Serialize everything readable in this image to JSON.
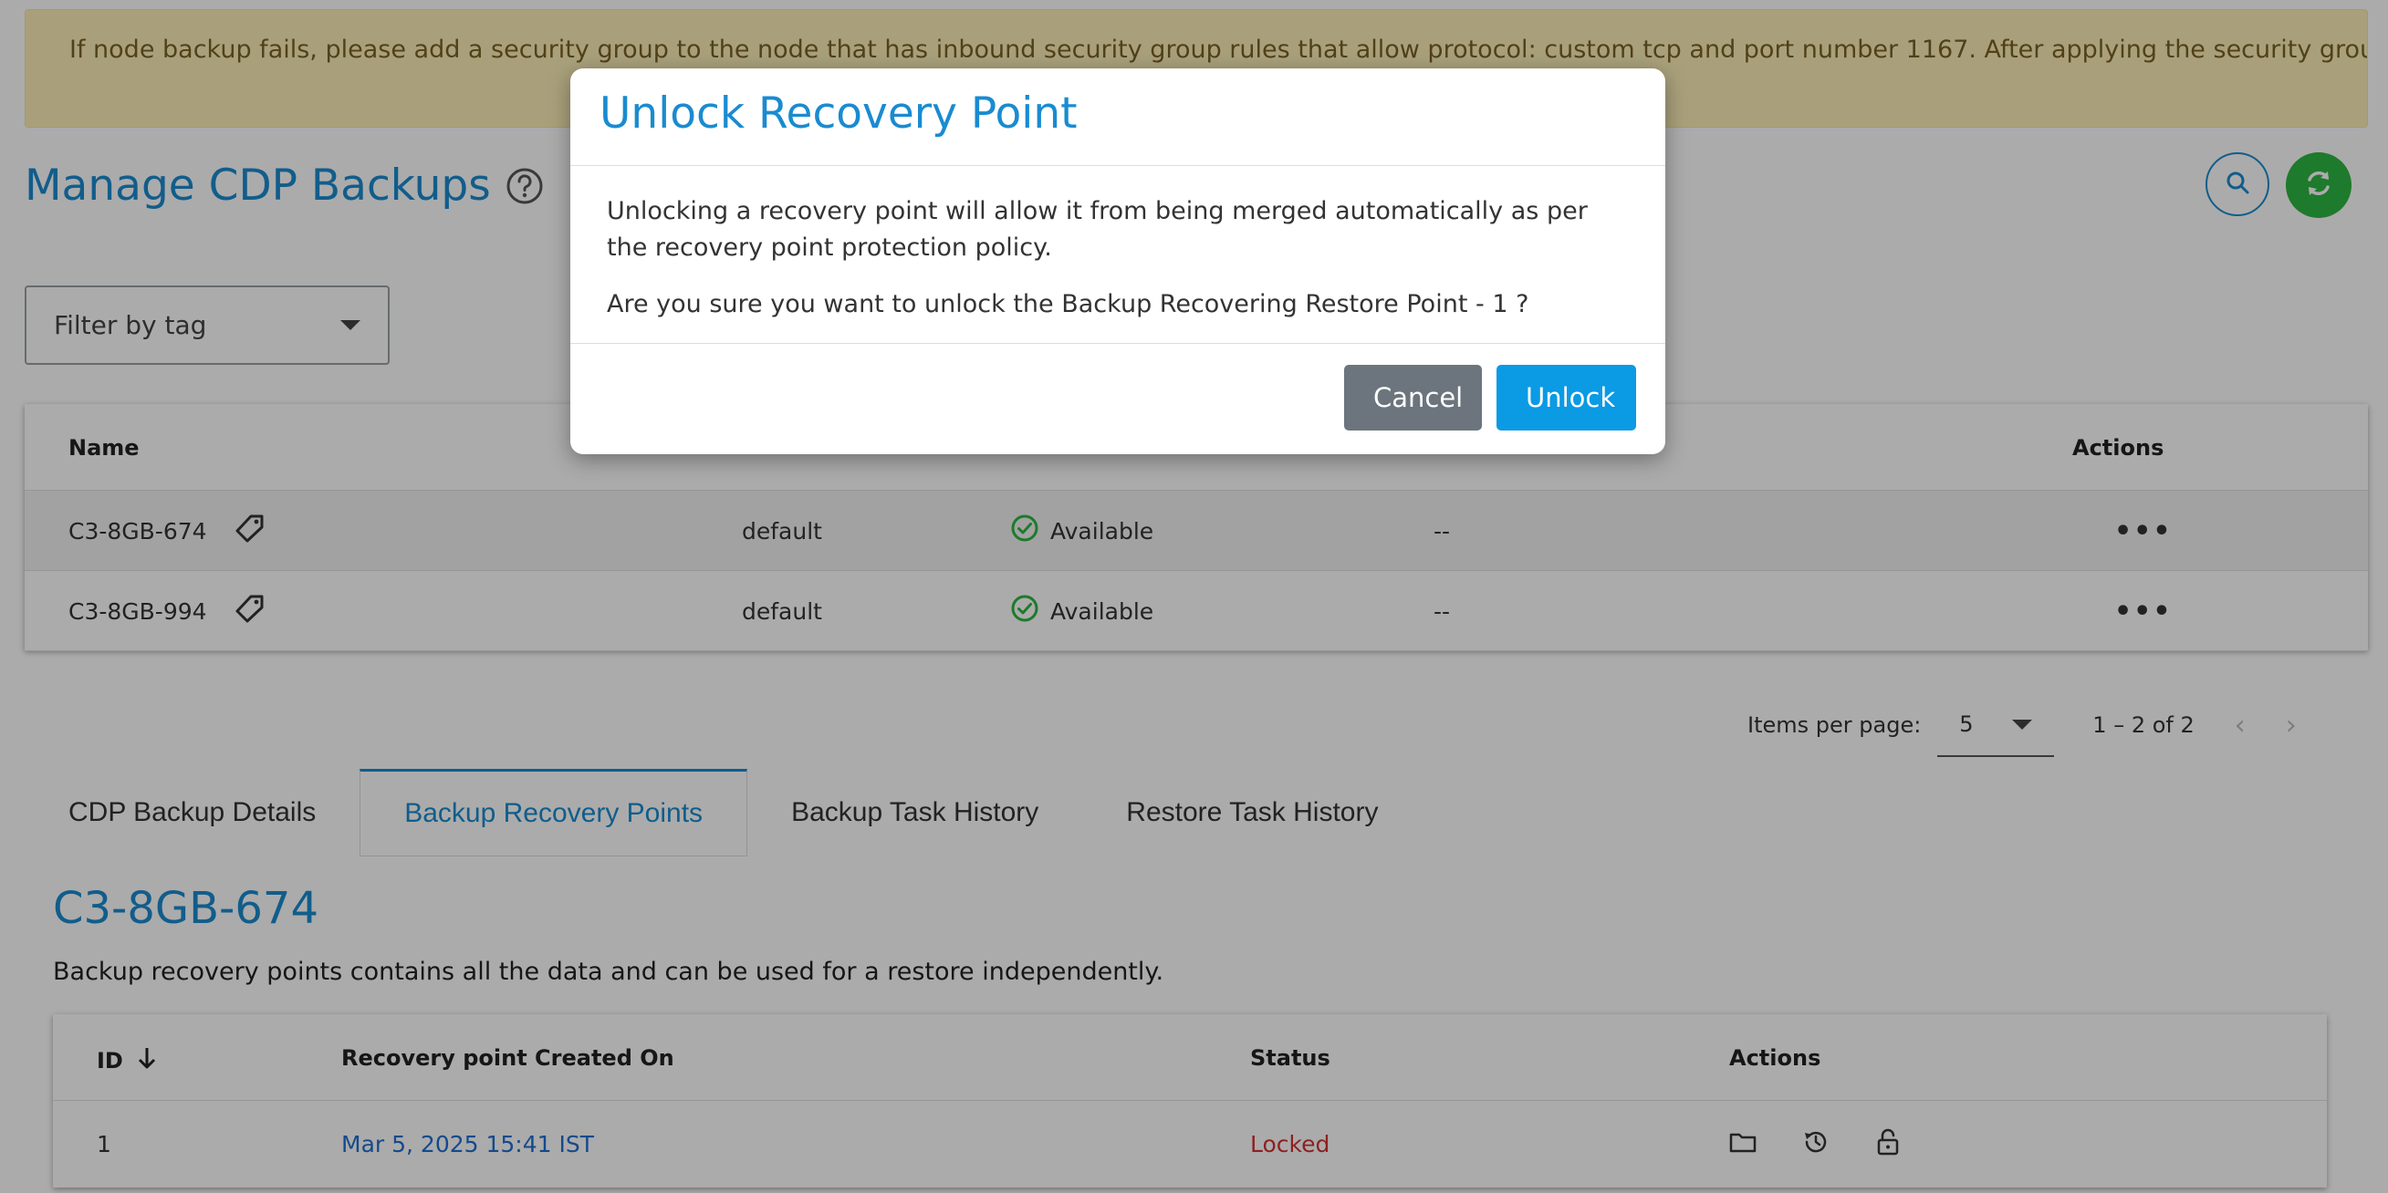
{
  "banner": {
    "text": "If node backup fails, please add a security group to the node that has inbound security group rules that allow protocol: custom tcp and port number 1167. After applying the security group to"
  },
  "header": {
    "title": "Manage CDP Backups",
    "help_icon": "question-circle-icon",
    "search_icon": "search-icon",
    "refresh_icon": "refresh-icon"
  },
  "filter": {
    "placeholder": "Filter by tag"
  },
  "backups_table": {
    "columns": {
      "name": "Name",
      "actions": "Actions"
    },
    "rows": [
      {
        "name": "C3-8GB-674",
        "group": "default",
        "status": "Available",
        "tag": "--",
        "actions": "•••"
      },
      {
        "name": "C3-8GB-994",
        "group": "default",
        "status": "Available",
        "tag": "--",
        "actions": "•••"
      }
    ]
  },
  "pagination": {
    "label": "Items per page:",
    "value": "5",
    "range": "1 – 2 of 2",
    "prev": "‹",
    "next": "›"
  },
  "tabs": [
    {
      "label": "CDP Backup Details"
    },
    {
      "label": "Backup Recovery Points"
    },
    {
      "label": "Backup Task History"
    },
    {
      "label": "Restore Task History"
    }
  ],
  "details": {
    "title": "C3-8GB-674",
    "description": "Backup recovery points contains all the data and can be used for a restore independently."
  },
  "recovery_table": {
    "columns": {
      "id": "ID",
      "created": "Recovery point Created On",
      "status": "Status",
      "actions": "Actions"
    },
    "rows": [
      {
        "id": "1",
        "created": "Mar 5, 2025 15:41 IST",
        "status": "Locked"
      }
    ]
  },
  "dialog": {
    "title": "Unlock Recovery Point",
    "message1": "Unlocking a recovery point will allow it from being merged automatically as per the recovery point protection policy.",
    "message2": "Are you sure you want to unlock the Backup Recovering Restore Point - 1 ?",
    "cancel": "Cancel",
    "confirm": "Unlock"
  },
  "colors": {
    "accent": "#1a8bd0",
    "success": "#2db742",
    "locked": "#d63031",
    "link": "#1e6fd1",
    "banner_bg": "#fdefb8"
  }
}
